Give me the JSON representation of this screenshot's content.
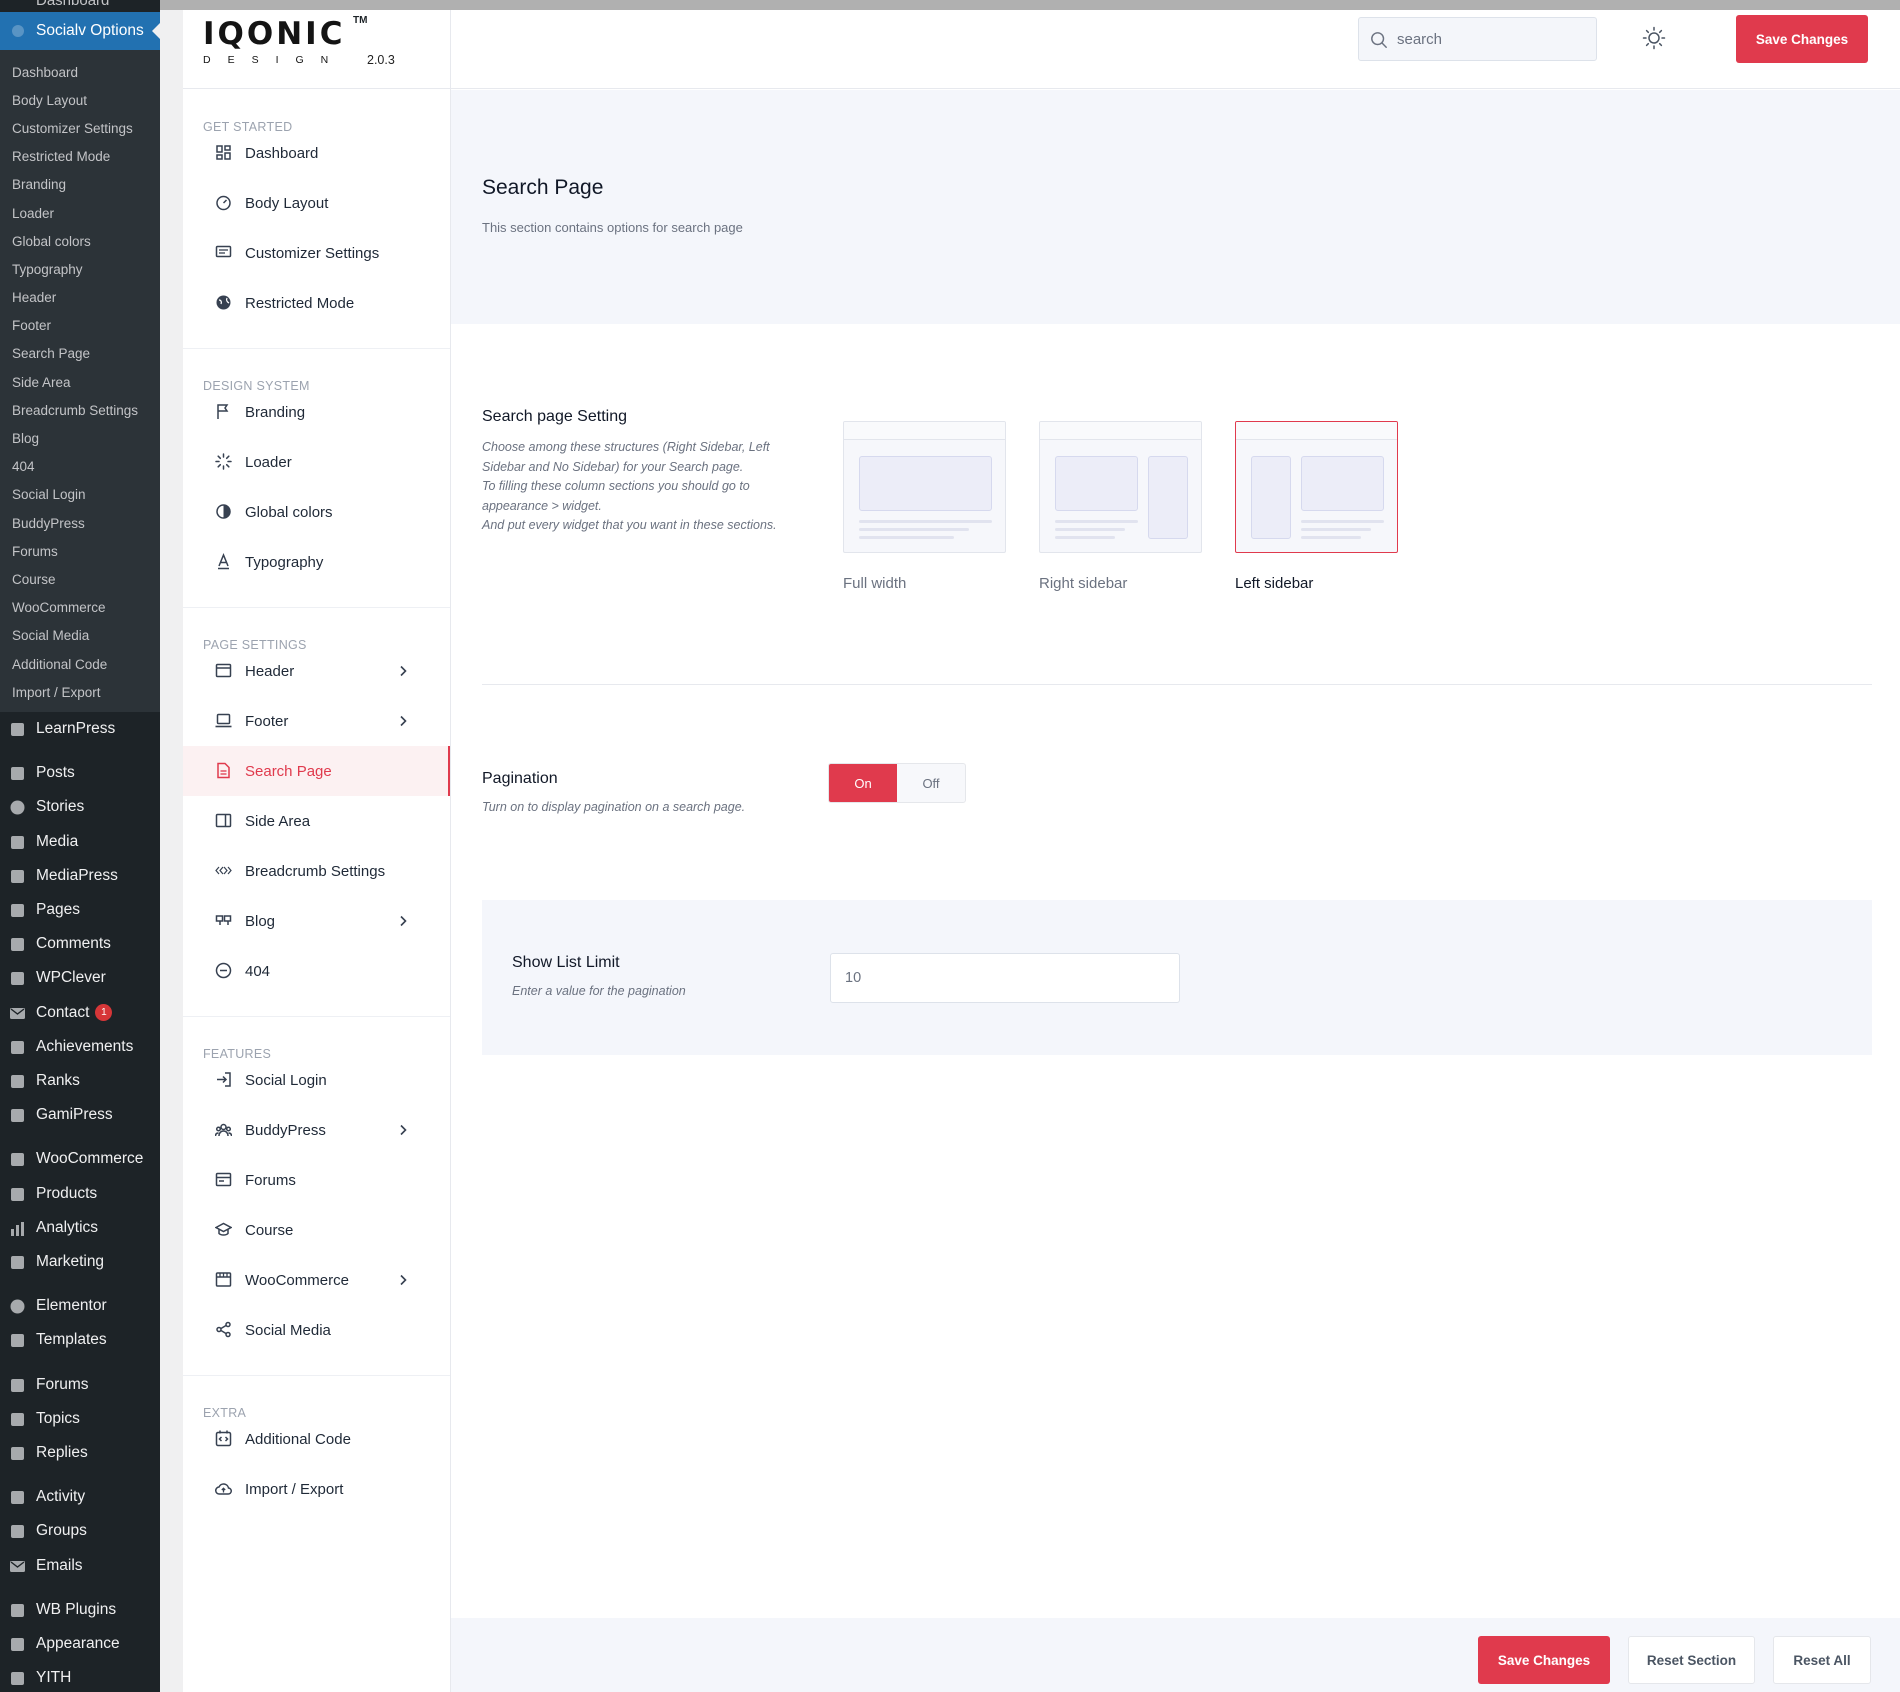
{
  "wp_sidebar": {
    "top_cut_label": "Dashboard",
    "active_menu": "Socialv Options",
    "submenu": [
      "Dashboard",
      "Body Layout",
      "Customizer Settings",
      "Restricted Mode",
      "Branding",
      "Loader",
      "Global colors",
      "Typography",
      "Header",
      "Footer",
      "Search Page",
      "Side Area",
      "Breadcrumb Settings",
      "Blog",
      "404",
      "Social Login",
      "BuddyPress",
      "Forums",
      "Course",
      "WooCommerce",
      "Social Media",
      "Additional Code",
      "Import / Export"
    ],
    "menu": [
      {
        "label": "LearnPress",
        "icon": "graduation-cap-icon"
      },
      {
        "label": "Posts",
        "icon": "pin-icon"
      },
      {
        "label": "Stories",
        "icon": "circle-icon"
      },
      {
        "label": "Media",
        "icon": "media-icon"
      },
      {
        "label": "MediaPress",
        "icon": "gallery-icon"
      },
      {
        "label": "Pages",
        "icon": "pages-icon"
      },
      {
        "label": "Comments",
        "icon": "comment-icon"
      },
      {
        "label": "WPClever",
        "icon": "bulb-icon"
      },
      {
        "label": "Contact",
        "icon": "mail-icon",
        "badge": "1"
      },
      {
        "label": "Achievements",
        "icon": "award-icon"
      },
      {
        "label": "Ranks",
        "icon": "ranks-icon"
      },
      {
        "label": "GamiPress",
        "icon": "crown-icon"
      },
      {
        "label": "WooCommerce",
        "icon": "woo-icon"
      },
      {
        "label": "Products",
        "icon": "archive-icon"
      },
      {
        "label": "Analytics",
        "icon": "bar-chart-icon"
      },
      {
        "label": "Marketing",
        "icon": "megaphone-icon"
      },
      {
        "label": "Elementor",
        "icon": "elementor-icon"
      },
      {
        "label": "Templates",
        "icon": "folder-icon"
      },
      {
        "label": "Forums",
        "icon": "forums-icon"
      },
      {
        "label": "Topics",
        "icon": "topics-icon"
      },
      {
        "label": "Replies",
        "icon": "replies-icon"
      },
      {
        "label": "Activity",
        "icon": "activity-icon"
      },
      {
        "label": "Groups",
        "icon": "groups-icon"
      },
      {
        "label": "Emails",
        "icon": "mail-icon"
      },
      {
        "label": "WB Plugins",
        "icon": "bulb-icon"
      },
      {
        "label": "Appearance",
        "icon": "brush-icon"
      },
      {
        "label": "YITH",
        "icon": "yith-icon"
      }
    ]
  },
  "header": {
    "logo_text": "IQONIC",
    "logo_sub": "DESIGN",
    "logo_tm": "TM",
    "version": "2.0.3",
    "search_placeholder": "search",
    "save_label": "Save Changes"
  },
  "options_nav": [
    {
      "title": "GET STARTED",
      "items": [
        {
          "label": "Dashboard",
          "icon": "dashboard-icon"
        },
        {
          "label": "Body Layout",
          "icon": "gauge-icon"
        },
        {
          "label": "Customizer Settings",
          "icon": "monitor-icon"
        },
        {
          "label": "Restricted Mode",
          "icon": "globe-icon"
        }
      ]
    },
    {
      "title": "DESIGN SYSTEM",
      "items": [
        {
          "label": "Branding",
          "icon": "flag-icon"
        },
        {
          "label": "Loader",
          "icon": "loader-icon"
        },
        {
          "label": "Global colors",
          "icon": "contrast-icon"
        },
        {
          "label": "Typography",
          "icon": "typography-icon"
        }
      ]
    },
    {
      "title": "PAGE SETTINGS",
      "items": [
        {
          "label": "Header",
          "icon": "header-icon",
          "chevron": true
        },
        {
          "label": "Footer",
          "icon": "laptop-icon",
          "chevron": true
        },
        {
          "label": "Search Page",
          "icon": "document-icon",
          "active": true
        },
        {
          "label": "Side Area",
          "icon": "side-area-icon"
        },
        {
          "label": "Breadcrumb Settings",
          "icon": "breadcrumb-icon"
        },
        {
          "label": "Blog",
          "icon": "quote-icon",
          "chevron": true
        },
        {
          "label": "404",
          "icon": "minus-circle-icon"
        }
      ]
    },
    {
      "title": "FEATURES",
      "items": [
        {
          "label": "Social Login",
          "icon": "login-icon"
        },
        {
          "label": "BuddyPress",
          "icon": "users-icon",
          "chevron": true
        },
        {
          "label": "Forums",
          "icon": "forum-icon"
        },
        {
          "label": "Course",
          "icon": "graduation-cap-icon"
        },
        {
          "label": "WooCommerce",
          "icon": "store-icon",
          "chevron": true
        },
        {
          "label": "Social Media",
          "icon": "share-icon"
        }
      ]
    },
    {
      "title": "EXTRA",
      "items": [
        {
          "label": "Additional Code",
          "icon": "code-icon"
        },
        {
          "label": "Import / Export",
          "icon": "cloud-icon"
        }
      ]
    }
  ],
  "content": {
    "title": "Search Page",
    "description": "This section contains options for search page",
    "layout_setting": {
      "label": "Search page Setting",
      "help": [
        "Choose among these structures (Right Sidebar, Left Sidebar and No Sidebar) for your Search page.",
        "To filling these column sections you should go to appearance > widget.",
        "And put every widget that you want in these sections."
      ],
      "options": [
        {
          "label": "Full width",
          "kind": "full"
        },
        {
          "label": "Right sidebar",
          "kind": "right"
        },
        {
          "label": "Left sidebar",
          "kind": "left",
          "selected": true
        }
      ]
    },
    "pagination": {
      "label": "Pagination",
      "help": "Turn on to display pagination on a search page.",
      "on_label": "On",
      "off_label": "Off",
      "value": "On"
    },
    "list_limit": {
      "label": "Show List Limit",
      "help": "Enter a value for the pagination",
      "value": "10"
    }
  },
  "footer": {
    "save_label": "Save Changes",
    "reset_section_label": "Reset Section",
    "reset_all_label": "Reset All"
  },
  "colors": {
    "accent": "#e03a4d",
    "wp_sidebar": "#1d2327",
    "wp_active": "#2271b1"
  }
}
